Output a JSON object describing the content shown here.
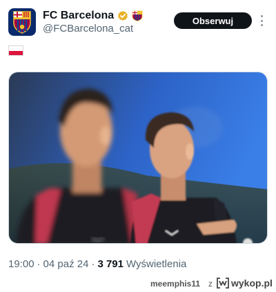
{
  "tweet": {
    "display_name": "FC Barcelona",
    "handle": "@FCBarcelona_cat",
    "follow_label": "Obserwuj",
    "content_flag": "poland-flag",
    "time": "19:00",
    "separator": "·",
    "date": "04 paź 24",
    "views_count": "3 791",
    "views_label": "Wyświetlenia"
  },
  "icons": {
    "verified": "verified-badge-icon",
    "club_crest": "fc-barcelona-crest-icon",
    "more": "more-options-icon"
  },
  "colors": {
    "follow_button": "#0f1419",
    "verified_gold": "#e8b228",
    "secondary_text": "#536471",
    "flag_red": "#dc143c"
  },
  "footer": {
    "user": "meemphis11",
    "z": "z",
    "site": "wykop.pl"
  }
}
